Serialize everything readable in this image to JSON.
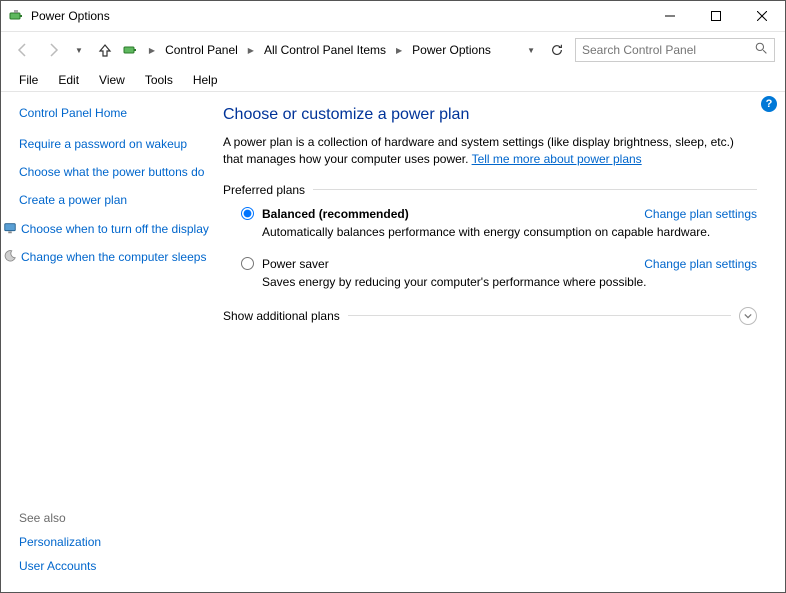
{
  "window": {
    "title": "Power Options"
  },
  "breadcrumb": {
    "items": [
      "Control Panel",
      "All Control Panel Items",
      "Power Options"
    ]
  },
  "search": {
    "placeholder": "Search Control Panel"
  },
  "menu": {
    "items": [
      "File",
      "Edit",
      "View",
      "Tools",
      "Help"
    ]
  },
  "sidebar": {
    "home": "Control Panel Home",
    "links": [
      {
        "label": "Require a password on wakeup",
        "icon": null
      },
      {
        "label": "Choose what the power buttons do",
        "icon": null
      },
      {
        "label": "Create a power plan",
        "icon": null
      },
      {
        "label": "Choose when to turn off the display",
        "icon": "monitor"
      },
      {
        "label": "Change when the computer sleeps",
        "icon": "moon"
      }
    ],
    "see_also_heading": "See also",
    "see_also": [
      "Personalization",
      "User Accounts"
    ]
  },
  "main": {
    "heading": "Choose or customize a power plan",
    "description": "A power plan is a collection of hardware and system settings (like display brightness, sleep, etc.) that manages how your computer uses power. ",
    "desc_link": "Tell me more about power plans",
    "preferred_heading": "Preferred plans",
    "plans": [
      {
        "name": "Balanced (recommended)",
        "selected": true,
        "desc": "Automatically balances performance with energy consumption on capable hardware.",
        "change": "Change plan settings"
      },
      {
        "name": "Power saver",
        "selected": false,
        "desc": "Saves energy by reducing your computer's performance where possible.",
        "change": "Change plan settings"
      }
    ],
    "expand_label": "Show additional plans"
  }
}
